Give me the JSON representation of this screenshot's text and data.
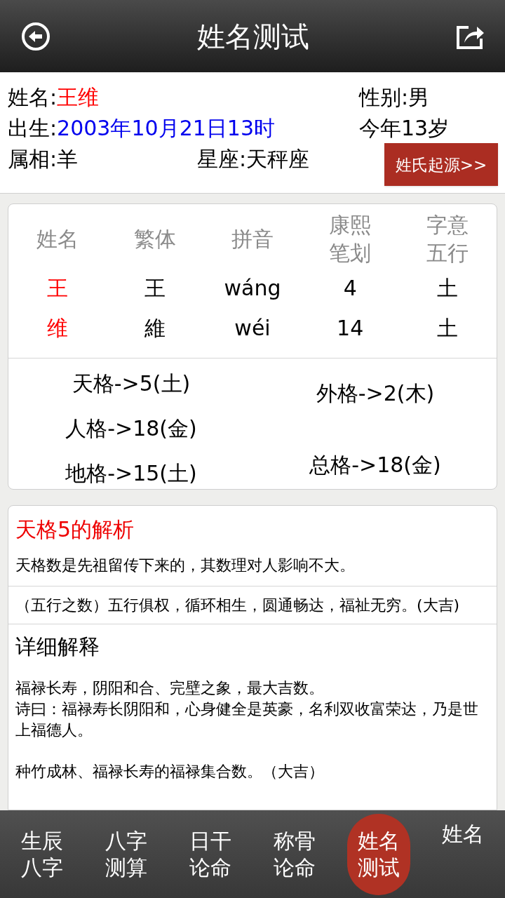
{
  "header": {
    "title": "姓名测试"
  },
  "info": {
    "name_label": "姓名:",
    "name_value": "王维",
    "gender": "性别:男",
    "birth_label": "出生:",
    "birth_value": "2003年10月21日13时",
    "age": "今年13岁",
    "zodiac": "属相:羊",
    "constellation": "星座:天秤座",
    "origin_button": "姓氏起源>>"
  },
  "table": {
    "columns": [
      "姓名",
      "繁体",
      "拼音",
      "康熙笔划",
      "字意五行"
    ],
    "rows": [
      [
        "王",
        "王",
        "wáng",
        "4",
        "土"
      ],
      [
        "维",
        "維",
        "wéi",
        "14",
        "土"
      ]
    ]
  },
  "grids": {
    "left": [
      "天格->5(土)",
      "人格->18(金)",
      "地格->15(土)"
    ],
    "right": [
      "外格->2(木)",
      "总格->18(金)"
    ]
  },
  "analysis": {
    "title": "天格5的解析",
    "intro": "天格数是先祖留传下来的，其数理对人影响不大。",
    "wuxing": "（五行之数）五行俱权，循环相生，圆通畅达，福祉无穷。(大吉)",
    "detail_title": "详细解释",
    "detail_blocks": [
      [
        "福禄长寿，阴阳和合、完壁之象，最大吉数。",
        "诗曰：福禄寿长阴阳和，心身健全是英豪，名利双收富荣达，乃是世上福德人。"
      ],
      [
        "种竹成林、福禄长寿的福禄集合数。（大吉）"
      ]
    ]
  },
  "nav": [
    {
      "lines": [
        "生辰",
        "八字"
      ],
      "selected": false
    },
    {
      "lines": [
        "八字",
        "测算"
      ],
      "selected": false
    },
    {
      "lines": [
        "日干",
        "论命"
      ],
      "selected": false
    },
    {
      "lines": [
        "称骨",
        "论命"
      ],
      "selected": false
    },
    {
      "lines": [
        "姓名",
        "测试"
      ],
      "selected": true
    },
    {
      "lines": [
        "姓名"
      ],
      "selected": false
    }
  ]
}
